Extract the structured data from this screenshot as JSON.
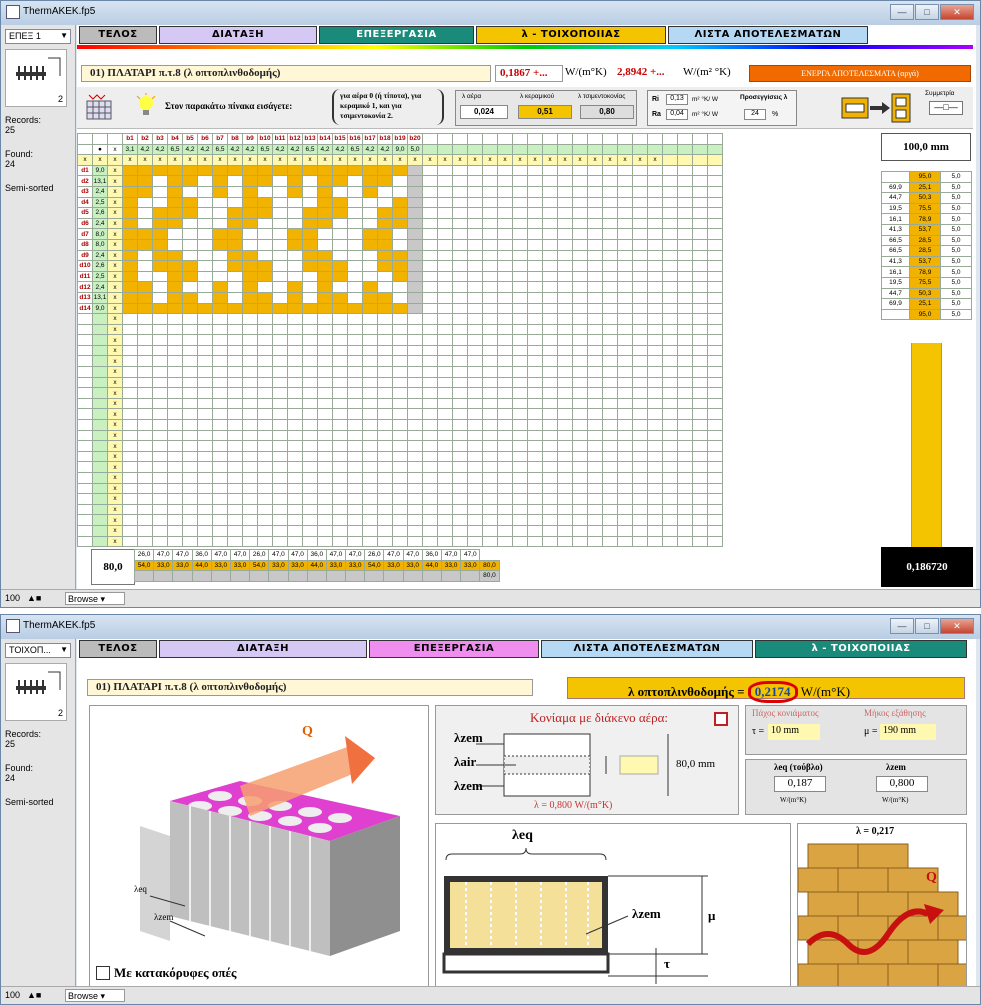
{
  "window1": {
    "title": "ThermAKEK.fp5",
    "dropdown": "ΕΠΕΞ 1",
    "records_label": "Records:",
    "records_value": "25",
    "found_label": "Found:",
    "found_value": "24",
    "sort_label": "Semi-sorted",
    "book_number": "2",
    "tabs": [
      "ΤΕΛΟΣ",
      "ΔΙΑΤΑΞΗ",
      "ΕΠΕΞΕΡΓΑΣΙΑ",
      "λ - ΤΟΙΧΟΠΟΙΙΑΣ",
      "ΛΙΣΤΑ ΑΠΟΤΕΛΕΣΜΑΤΩΝ"
    ],
    "record_title": "01) ΠΛΑΤΑΡΙ π.τ.8 (λ οπτοπλινθοδομής)",
    "u_value": "0,1867",
    "u_unit": "W/(m°K)",
    "r_value": "2,8942",
    "r_unit": "W/(m² °K)",
    "results_button": "ΕΝΕΡΓΑ ΑΠΟΤΕΛΕΣΜΑΤΑ (αργά)",
    "instruction": "Στον παρακάτω πίνακα εισάγετε:",
    "instruction_options": "για αέρα 0 (ή τίποτα), για κεραμικό 1, και για τσιμεντοκονία 2.",
    "air_label": "λ αέρα",
    "air_value": "0,024",
    "ceramic_label": "λ κεραμικού",
    "ceramic_value": "0,51",
    "cement_label": "λ τσιμεντοκονίας",
    "cement_value": "0,80",
    "ri_label": "Ri",
    "ri_value": "0,13",
    "ri_unit": "m² °K/ W",
    "ra_label": "Ra",
    "ra_value": "0,04",
    "ra_unit": "m² °K/ W",
    "accuracy_label": "Προσεγγίσεις λ",
    "accuracy_value": "24",
    "accuracy_unit": "%",
    "symmetric_label": "Συμμετρία",
    "col_headers": [
      "b1",
      "b2",
      "b3",
      "b4",
      "b5",
      "b6",
      "b7",
      "b8",
      "b9",
      "b10",
      "b11",
      "b12",
      "b13",
      "b14",
      "b15",
      "b16",
      "b17",
      "b18",
      "b19",
      "b20"
    ],
    "col_widths": [
      "3,1",
      "4,2",
      "4,2",
      "6,5",
      "4,2",
      "4,2",
      "6,5",
      "4,2",
      "4,2",
      "6,5",
      "4,2",
      "4,2",
      "6,5",
      "4,2",
      "4,2",
      "6,5",
      "4,2",
      "4,2",
      "9,0",
      "5,0"
    ],
    "row_labels": [
      "d1",
      "d2",
      "d3",
      "d4",
      "d5",
      "d6",
      "d7",
      "d8",
      "d9",
      "d10",
      "d11",
      "d12",
      "d13",
      "d14"
    ],
    "row_values": [
      "9,0",
      "13,1",
      "2,4",
      "2,5",
      "2,6",
      "2,4",
      "8,0",
      "8,0",
      "2,4",
      "2,6",
      "2,5",
      "2,4",
      "13,1",
      "9,0"
    ],
    "thickness": "100,0 mm",
    "right_values": [
      [
        "",
        "95,0",
        "5,0"
      ],
      [
        "69,9",
        "25,1",
        "5,0"
      ],
      [
        "44,7",
        "50,3",
        "5,0"
      ],
      [
        "19,5",
        "75,5",
        "5,0"
      ],
      [
        "16,1",
        "78,9",
        "5,0"
      ],
      [
        "41,3",
        "53,7",
        "5,0"
      ],
      [
        "66,5",
        "28,5",
        "5,0"
      ],
      [
        "66,5",
        "28,5",
        "5,0"
      ],
      [
        "41,3",
        "53,7",
        "5,0"
      ],
      [
        "16,1",
        "78,9",
        "5,0"
      ],
      [
        "19,5",
        "75,5",
        "5,0"
      ],
      [
        "44,7",
        "50,3",
        "5,0"
      ],
      [
        "69,9",
        "25,1",
        "5,0"
      ],
      [
        "",
        "95,0",
        "5,0"
      ]
    ],
    "bottom_total": "80,0",
    "bottom_row1": [
      "26,0",
      "47,0",
      "47,0",
      "36,0",
      "47,0",
      "47,0",
      "26,0",
      "47,0",
      "47,0",
      "36,0",
      "47,0",
      "47,0",
      "26,0",
      "47,0",
      "47,0",
      "36,0",
      "47,0",
      "47,0"
    ],
    "bottom_row2": [
      "54,0",
      "33,0",
      "33,0",
      "44,0",
      "33,0",
      "33,0",
      "54,0",
      "33,0",
      "33,0",
      "44,0",
      "33,0",
      "33,0",
      "54,0",
      "33,0",
      "33,0",
      "44,0",
      "33,0",
      "33,0",
      "80,0"
    ],
    "bottom_extra": "80,0",
    "result": "0,186720",
    "zoom": "100",
    "mode": "Browse"
  },
  "window2": {
    "title": "ThermAKEK.fp5",
    "dropdown": "ΤΟΙΧΟΠ...",
    "records_label": "Records:",
    "records_value": "25",
    "found_label": "Found:",
    "found_value": "24",
    "sort_label": "Semi-sorted",
    "book_number": "2",
    "tabs": [
      "ΤΕΛΟΣ",
      "ΔΙΑΤΑΞΗ",
      "ΕΠΕΞΕΡΓΑΣΙΑ",
      "ΛΙΣΤΑ ΑΠΟΤΕΛΕΣΜΑΤΩΝ",
      "λ - ΤΟΙΧΟΠΟΙΙΑΣ"
    ],
    "record_title": "01) ΠΛΑΤΑΡΙ π.τ.8 (λ οπτοπλινθοδομής)",
    "lambda_label": "λ οπτοπλινθοδομής",
    "lambda_value": "0,2174",
    "lambda_unit": "W/(m°K)",
    "mortar_label": "Κονίαμα με διάκενο αέρα:",
    "mortar_thickness_label": "Πάχος κονιάματος",
    "joint_length_label": "Μήκος εξάθησης",
    "tau_label": "τ =",
    "tau_value": "10 mm",
    "mu_label": "μ =",
    "mu_value": "190 mm",
    "diagram_height": "80,0 mm",
    "lambda_mortar_line": "λ = 0,800 W/(m°K)",
    "leq_label": "λeq (τούβλο)",
    "leq_value": "0,187",
    "leq_unit": "W/(m°K)",
    "lzem_label": "λzem",
    "lzem_value": "0,800",
    "lzem_unit": "W/(m°K)",
    "label_zem": "λzem",
    "label_air": "λair",
    "label_eq": "λeq",
    "label_mu": "μ",
    "label_tau": "τ",
    "q_label": "Q",
    "brick_lambda": "λ = 0,217",
    "vertical_holes_label": "Με κατακόρυφες οπές",
    "zoom": "100",
    "mode": "Browse"
  }
}
